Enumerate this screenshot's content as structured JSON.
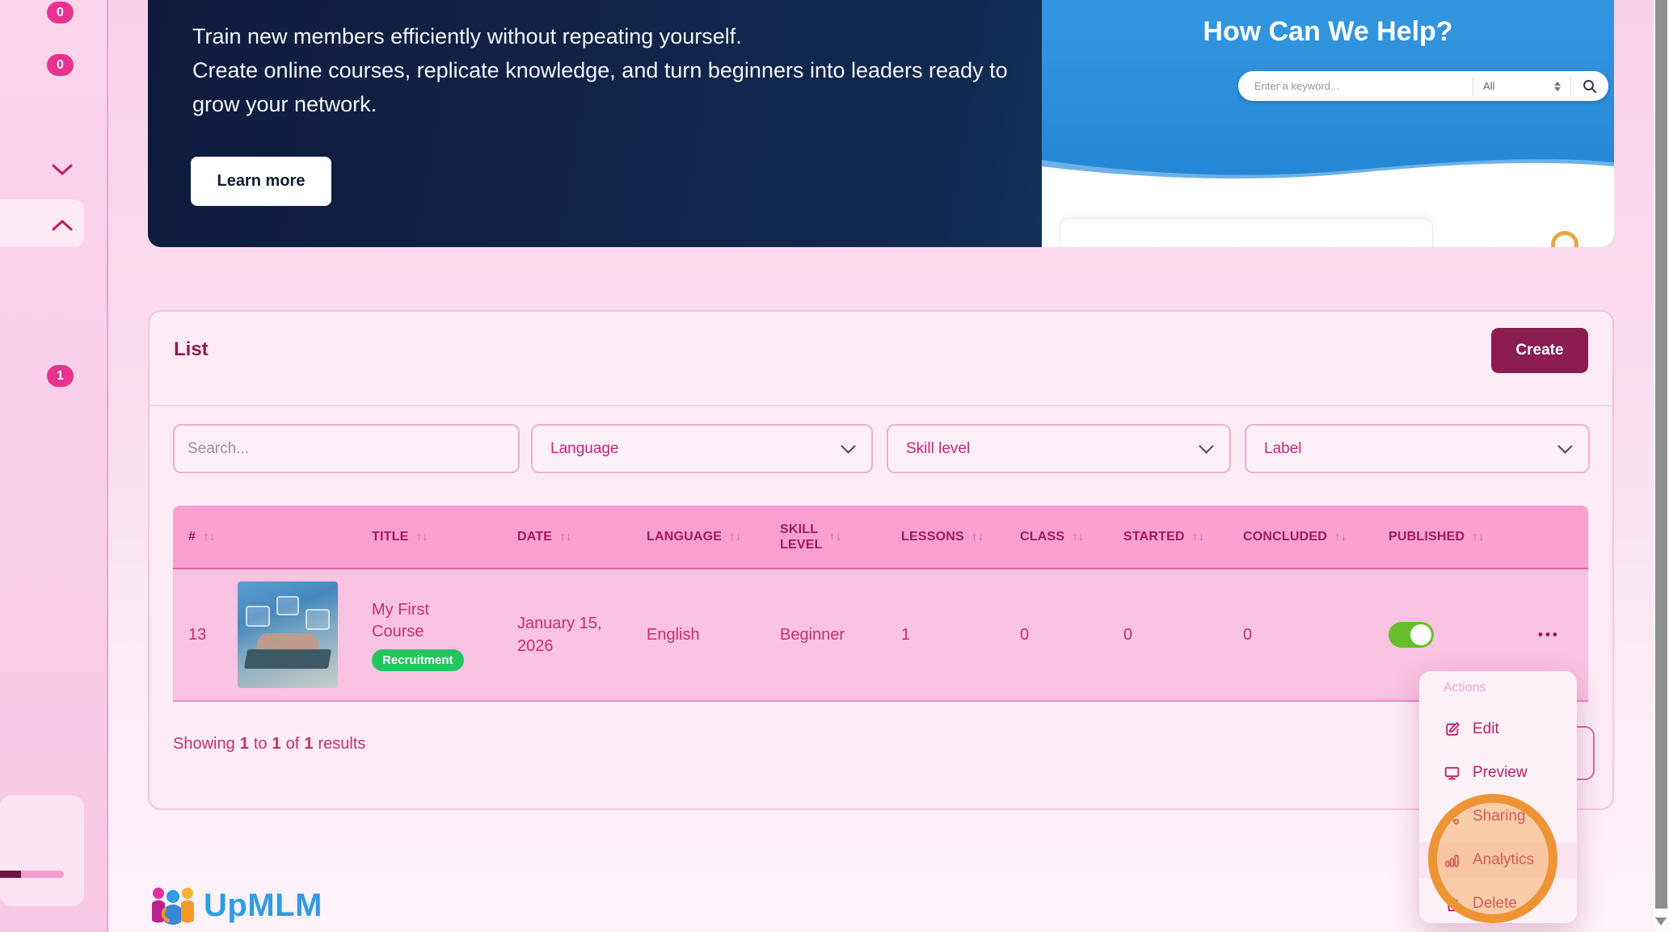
{
  "sidebar": {
    "badges": [
      "0",
      "0",
      "1"
    ]
  },
  "banner": {
    "lines": [
      "Train new members efficiently without repeating yourself.",
      "Create online courses, replicate knowledge, and turn beginners into leaders ready to",
      "grow your network."
    ],
    "learn_more": "Learn more"
  },
  "help_panel": {
    "title": "How Can We Help?",
    "search_placeholder": "Enter a keyword...",
    "category": "All"
  },
  "list_card": {
    "title": "List",
    "create_button": "Create",
    "filters": {
      "search_placeholder": "Search...",
      "language": "Language",
      "skill_level": "Skill level",
      "label": "Label"
    },
    "table": {
      "headers": {
        "index": "#",
        "title": "TITLE",
        "date": "DATE",
        "language": "LANGUAGE",
        "skill": "SKILL LEVEL",
        "lessons": "LESSONS",
        "class": "CLASS",
        "started": "STARTED",
        "concluded": "CONCLUDED",
        "published": "PUBLISHED"
      },
      "row": {
        "index": "13",
        "title": "My First Course",
        "label_badge": "Recruitment",
        "date": "January 15, 2026",
        "language": "English",
        "skill": "Beginner",
        "lessons": "1",
        "class": "0",
        "started": "0",
        "concluded": "0",
        "published": true
      }
    },
    "results": {
      "showing": "Showing",
      "from": "1",
      "to_word": "to",
      "to": "1",
      "of_word": "of",
      "total": "1",
      "results_word": "results"
    }
  },
  "actions_menu": {
    "title": "Actions",
    "items": [
      {
        "icon": "edit-icon",
        "label": "Edit"
      },
      {
        "icon": "preview-icon",
        "label": "Preview"
      },
      {
        "icon": "sharing-icon",
        "label": "Sharing"
      },
      {
        "icon": "analytics-icon",
        "label": "Analytics"
      },
      {
        "icon": "delete-icon",
        "label": "Delete"
      }
    ]
  },
  "footer": {
    "brand": "UpMLM"
  },
  "glyphs": {
    "sort": "↑↓",
    "ellipsis": "•••"
  },
  "colors": {
    "accent_maroon": "#8b1d51",
    "magenta_text": "#c2267a",
    "table_header_bg": "#f8a0d1",
    "table_row_bg": "#fac3e1",
    "badge_pink": "#e7338f",
    "success_green": "#23c55e",
    "toggle_green": "#66be2b",
    "annotation_orange": "#ef9434",
    "brand_blue": "#2f9ce6",
    "help_blue": "#2188d8",
    "banner_navy": "#0e1b3d"
  }
}
